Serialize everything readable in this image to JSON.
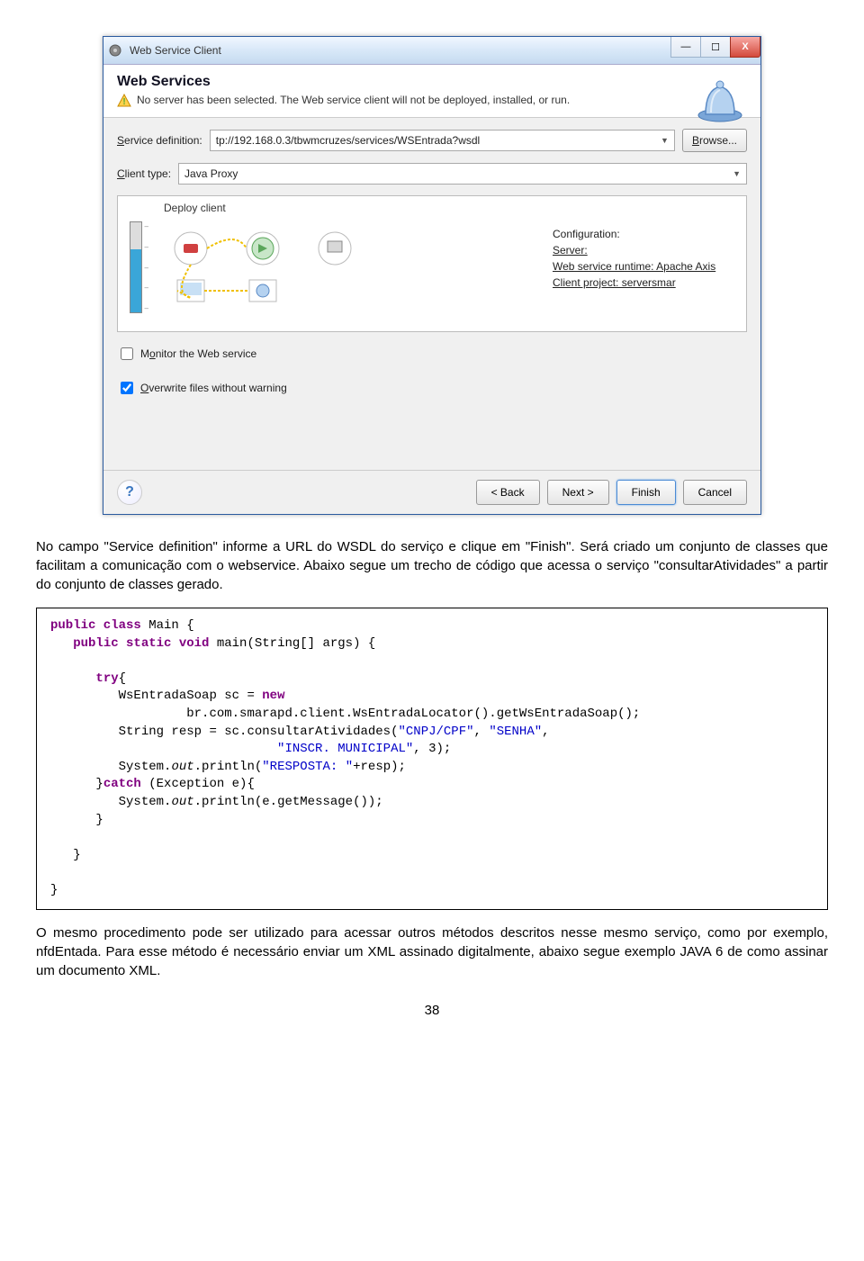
{
  "window": {
    "title": "Web Service Client",
    "header_title": "Web Services",
    "warning_text": "No server has been selected. The Web service client will not be deployed, installed, or run.",
    "service_def_label": "Service definition:",
    "service_def_value": "tp://192.168.0.3/tbwmcruzes/services/WSEntrada?wsdl",
    "browse_label": "Browse...",
    "client_type_label": "Client type:",
    "client_type_value": "Java Proxy",
    "deploy_label": "Deploy client",
    "config": {
      "title": "Configuration:",
      "server": "Server:",
      "runtime": "Web service runtime: Apache Axis",
      "project": "Client project: serversmar"
    },
    "monitor_label": "Monitor the Web service",
    "overwrite_label": "Overwrite files without warning",
    "buttons": {
      "back": "< Back",
      "next": "Next >",
      "finish": "Finish",
      "cancel": "Cancel"
    }
  },
  "doc": {
    "para1": "No campo \"Service definition\" informe a URL do WSDL do serviço e clique em \"Finish\". Será criado um conjunto de classes que facilitam a comunicação com o webservice. Abaixo segue um trecho de código que acessa o serviço \"consultarAtividades\" a partir do conjunto de classes gerado.",
    "para2": "O mesmo procedimento pode ser utilizado para acessar outros métodos descritos nesse mesmo serviço, como por exemplo, nfdEntada. Para esse método é necessário enviar um XML assinado digitalmente, abaixo segue exemplo JAVA 6 de como assinar um documento XML.",
    "page_num": "38"
  },
  "code": {
    "line1a": "public class",
    "line1b": " Main {",
    "line2a": "public static void",
    "line2b": " main(String[] args) {",
    "line3": "try",
    "line3b": "{",
    "line4a": "WsEntradaSoap sc = ",
    "line4b": "new",
    "line5a": "br.com.smarapd.client.WsEntradaLocator().getWsEntradaSoap();",
    "line6a": "String resp = sc.consultarAtividades(",
    "line6s1": "\"CNPJ/CPF\"",
    "line6c1": ", ",
    "line6s2": "\"SENHA\"",
    "line6c2": ",",
    "line7s": "\"INSCR. MUNICIPAL\"",
    "line7b": ", 3);",
    "line8a": "System.",
    "line8b": "out",
    "line8c": ".println(",
    "line8s": "\"RESPOSTA: \"",
    "line8d": "+resp);",
    "line9a": "}",
    "line9b": "catch",
    "line9c": " (Exception e){",
    "line10a": "System.",
    "line10b": "out",
    "line10c": ".println(e.getMessage());",
    "line11": "}",
    "line12": "}",
    "line13": "}"
  }
}
